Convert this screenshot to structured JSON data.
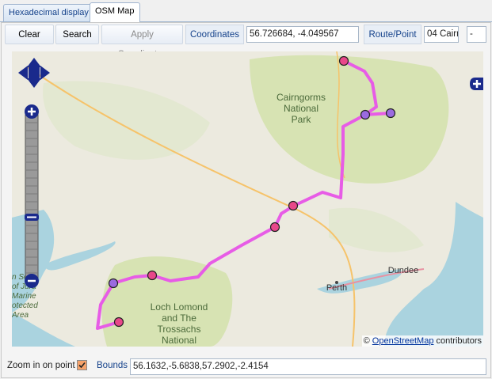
{
  "tabs": [
    {
      "label": "Hexadecimal display"
    },
    {
      "label": "OSM Map"
    }
  ],
  "toolbar": {
    "clear_map": "Clear map",
    "search": "Search",
    "apply_coordinates": "Apply Coordinates",
    "coordinates_label": "Coordinates",
    "coordinates_value": "56.726684, -4.049567",
    "route_point_label": "Route/Point",
    "route_point_value": "04 Cairn",
    "extra_value": "-"
  },
  "map": {
    "labels": {
      "cairngorms": [
        "Cairngorms",
        "National",
        "Park"
      ],
      "loch_lomond": [
        "Loch Lomond",
        "and The",
        "Trossachs",
        "National"
      ],
      "perth": "Perth",
      "dundee": "Dundee",
      "jura": [
        "n Sou",
        "of Jura",
        "Marine",
        "otected",
        "Area"
      ]
    },
    "attribution_prefix": "©",
    "attribution_link": "OpenStreetMap",
    "attribution_suffix": "contributors",
    "colors": {
      "route": "#e75ce6",
      "point_pink": "#e8488a",
      "point_purple": "#9b6ae0",
      "control": "#1a2a8c"
    }
  },
  "bottom": {
    "zoom_label": "Zoom in on point",
    "zoom_checked": true,
    "bounds_label": "Bounds",
    "bounds_value": "56.1632,-5.6838,57.2902,-2.4154"
  }
}
